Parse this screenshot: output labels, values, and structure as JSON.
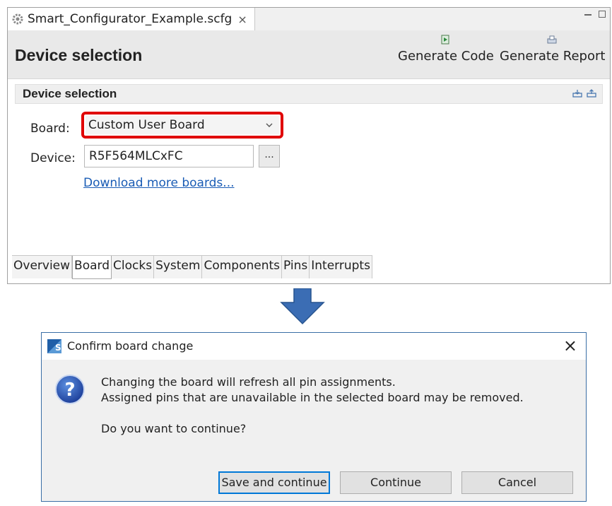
{
  "editor": {
    "file_tab": {
      "name": "Smart_Configurator_Example.scfg",
      "close": "×"
    },
    "header": {
      "title": "Device selection",
      "generate_code": "Generate Code",
      "generate_report": "Generate Report"
    },
    "section": {
      "title": "Device selection",
      "board_label": "Board:",
      "board_value": "Custom User Board",
      "device_label": "Device:",
      "device_value": "R5F564MLCxFC",
      "browse_label": "...",
      "download_link": "Download more boards..."
    },
    "bottom_tabs": [
      {
        "label": "Overview"
      },
      {
        "label": "Board",
        "active": true
      },
      {
        "label": "Clocks"
      },
      {
        "label": "System"
      },
      {
        "label": "Components"
      },
      {
        "label": "Pins"
      },
      {
        "label": "Interrupts"
      }
    ]
  },
  "dialog": {
    "title": "Confirm board change",
    "close": "×",
    "message_line1": "Changing the board will refresh all pin assignments.",
    "message_line2": "Assigned pins that are unavailable in the selected board may be removed.",
    "question": "Do you want to continue?",
    "buttons": {
      "save_and_continue": "Save and continue",
      "continue": "Continue",
      "cancel": "Cancel"
    }
  },
  "colors": {
    "highlight": "#e00000",
    "link": "#1a5cb5",
    "arrow": "#3b6db4",
    "dialog_border": "#3a6ea5",
    "focus": "#0078d7"
  },
  "icons": [
    "gear-icon",
    "close-icon",
    "minimize-icon",
    "maximize-icon",
    "generate-code-icon",
    "generate-report-icon",
    "import-icon",
    "export-icon",
    "chevron-down-icon",
    "down-arrow-icon",
    "app-icon",
    "question-icon"
  ]
}
